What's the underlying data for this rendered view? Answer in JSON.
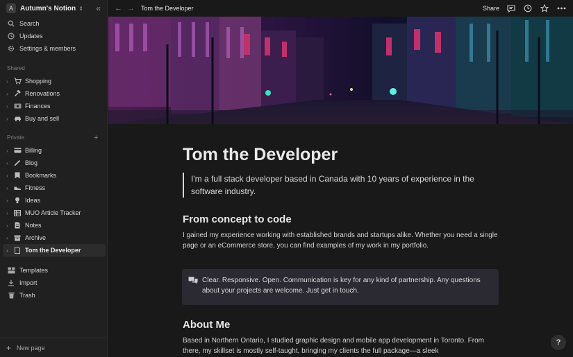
{
  "workspace": {
    "initial": "A",
    "name": "Autumn's Notion"
  },
  "nav": {
    "search": "Search",
    "updates": "Updates",
    "settings": "Settings & members"
  },
  "shared": {
    "label": "Shared",
    "items": [
      {
        "label": "Shopping",
        "icon": "cart-icon"
      },
      {
        "label": "Renovations",
        "icon": "hammer-icon"
      },
      {
        "label": "Finances",
        "icon": "money-icon"
      },
      {
        "label": "Buy and sell",
        "icon": "car-icon"
      }
    ]
  },
  "private": {
    "label": "Private",
    "items": [
      {
        "label": "Billing",
        "icon": "card-icon"
      },
      {
        "label": "Blog",
        "icon": "pencil-icon"
      },
      {
        "label": "Bookmarks",
        "icon": "bookmark-icon"
      },
      {
        "label": "Fitness",
        "icon": "shoe-icon"
      },
      {
        "label": "Ideas",
        "icon": "bulb-icon"
      },
      {
        "label": "MUO Article Tracker",
        "icon": "table-icon"
      },
      {
        "label": "Notes",
        "icon": "document-icon"
      },
      {
        "label": "Archive",
        "icon": "archive-icon"
      },
      {
        "label": "Tom the Developer",
        "icon": "page-icon",
        "active": true
      }
    ]
  },
  "footer_nav": {
    "templates": "Templates",
    "import": "Import",
    "trash": "Trash"
  },
  "new_page": "New page",
  "topbar": {
    "title": "Tom the Developer",
    "share": "Share"
  },
  "page": {
    "title": "Tom the Developer",
    "quote": "I'm a full stack developer based in Canada with 10 years of experience in the software industry.",
    "section1_heading": "From concept to code",
    "section1_text": "I gained my experience working with established brands and startups alike. Whether you need a single page or an eCommerce store, you can find examples of my work in my portfolio.",
    "callout_text": "Clear. Responsive. Open. Communication is key for any kind of partnership. Any questions about your projects are welcome. Just get in touch.",
    "section2_heading": "About Me",
    "section2_text": "Based in Northern Ontario, I studied graphic design and mobile app development in Toronto. From there, my skillset is mostly self-taught, bringing my clients the full package—a sleek"
  },
  "help": "?",
  "colors": {
    "sidebar_bg": "#202020",
    "page_bg": "#191919",
    "callout_bg": "#2b2a33"
  }
}
